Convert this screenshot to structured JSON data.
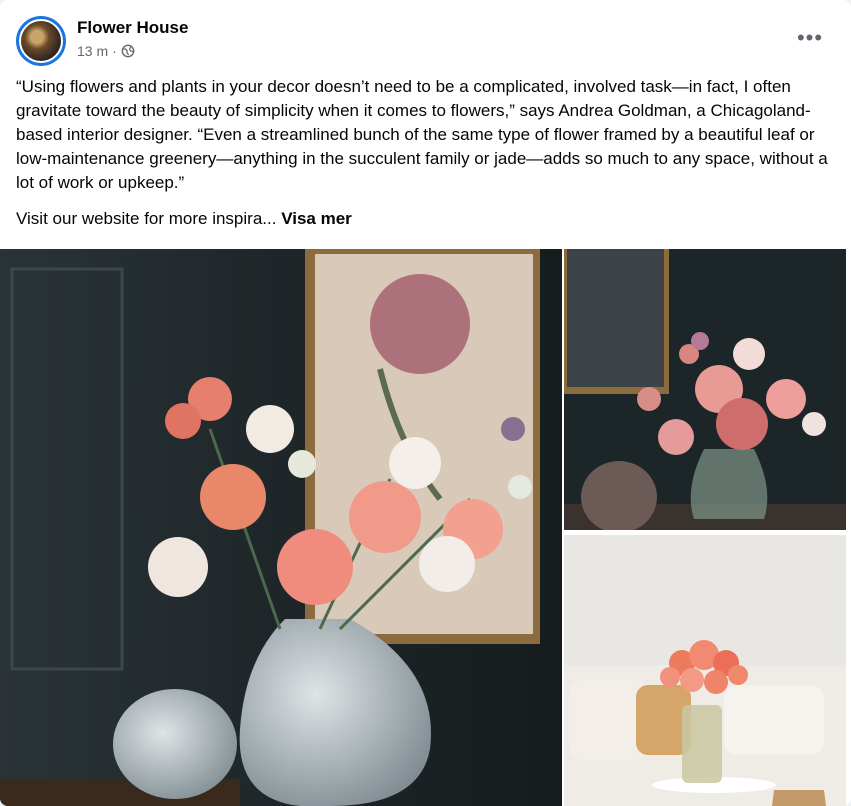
{
  "post": {
    "page_name": "Flower House",
    "time": "13 m",
    "separator": "·",
    "privacy_icon": "globe-icon",
    "more_icon": "more-options-icon",
    "more_label": "•••",
    "body": "“Using flowers and plants in your decor doesn’t need to be a complicated, involved task—in fact, I often gravitate toward the beauty of simplicity when it comes to flowers,” says Andrea Goldman, a Chicagoland-based interior designer. “Even a streamlined bunch of the same type of flower framed by a beautiful leaf or low-maintenance greenery—anything in the succulent family or jade—adds so much to any space, without a lot of work or upkeep.”",
    "teaser": "Visit our website for more inspira...",
    "see_more": "Visa mer"
  },
  "colors": {
    "accent": "#1b74e4",
    "text": "#050505",
    "secondary": "#65676b"
  }
}
